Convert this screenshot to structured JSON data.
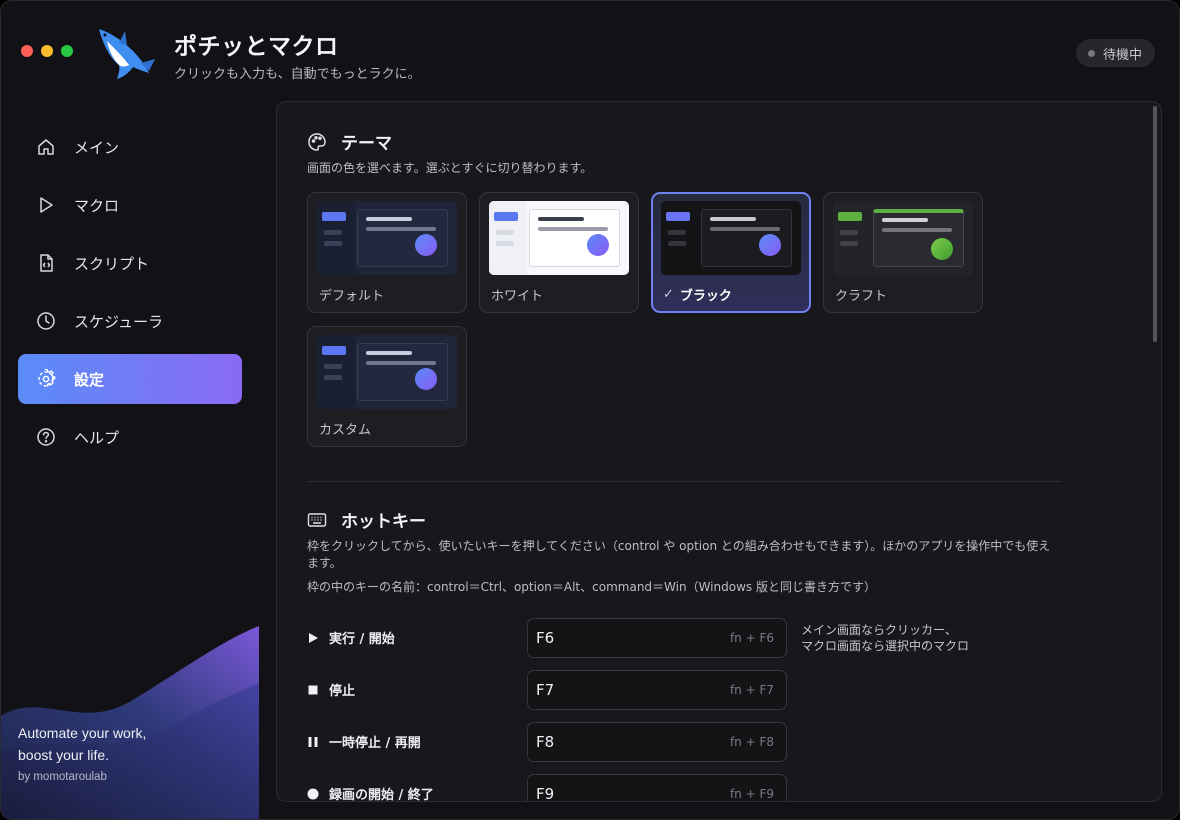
{
  "app": {
    "title": "ポチッとマクロ",
    "subtitle": "クリックも入力も、自動でもっとラクに。",
    "status": "待機中"
  },
  "sidebar": {
    "items": [
      {
        "label": "メイン",
        "icon": "home-icon"
      },
      {
        "label": "マクロ",
        "icon": "play-icon"
      },
      {
        "label": "スクリプト",
        "icon": "script-file-icon"
      },
      {
        "label": "スケジューラ",
        "icon": "clock-icon"
      },
      {
        "label": "設定",
        "icon": "gear-icon",
        "active": true
      },
      {
        "label": "ヘルプ",
        "icon": "help-icon"
      }
    ],
    "tagline_line1": "Automate your work,",
    "tagline_line2": "boost your life.",
    "byline": "by momotaroulab"
  },
  "theme": {
    "heading": "テーマ",
    "description": "画面の色を選べます。選ぶとすぐに切り替わります。",
    "options": [
      {
        "label": "デフォルト",
        "selected": false
      },
      {
        "label": "ホワイト",
        "selected": false
      },
      {
        "label": "ブラック",
        "selected": true
      },
      {
        "label": "クラフト",
        "selected": false
      },
      {
        "label": "カスタム",
        "selected": false
      }
    ],
    "check_mark": "✓"
  },
  "hotkey": {
    "heading": "ホットキー",
    "description_line1": "枠をクリックしてから、使いたいキーを押してください（control や option との組み合わせもできます）。ほかのアプリを操作中でも使え",
    "description_line2": "ます。",
    "key_names_note": "枠の中のキーの名前：control＝Ctrl、option＝Alt、command＝Win（Windows 版と同じ書き方です）",
    "rows": [
      {
        "label": "実行 / 開始",
        "key": "F6",
        "alt": "fn + F6",
        "icon": "play-solid-icon"
      },
      {
        "label": "停止",
        "key": "F7",
        "alt": "fn + F7",
        "icon": "stop-icon"
      },
      {
        "label": "一時停止 / 再開",
        "key": "F8",
        "alt": "fn + F8",
        "icon": "pause-icon"
      },
      {
        "label": "録画の開始 / 終了",
        "key": "F9",
        "alt": "fn + F9",
        "icon": "record-icon"
      }
    ],
    "run_note_line1": "メイン画面ならクリッカー、",
    "run_note_line2": "マクロ画面なら選択中のマクロ"
  },
  "colors": {
    "accent_start": "#5a8cf7",
    "accent_end": "#8a6af5",
    "selected_border": "#6f82f0"
  }
}
